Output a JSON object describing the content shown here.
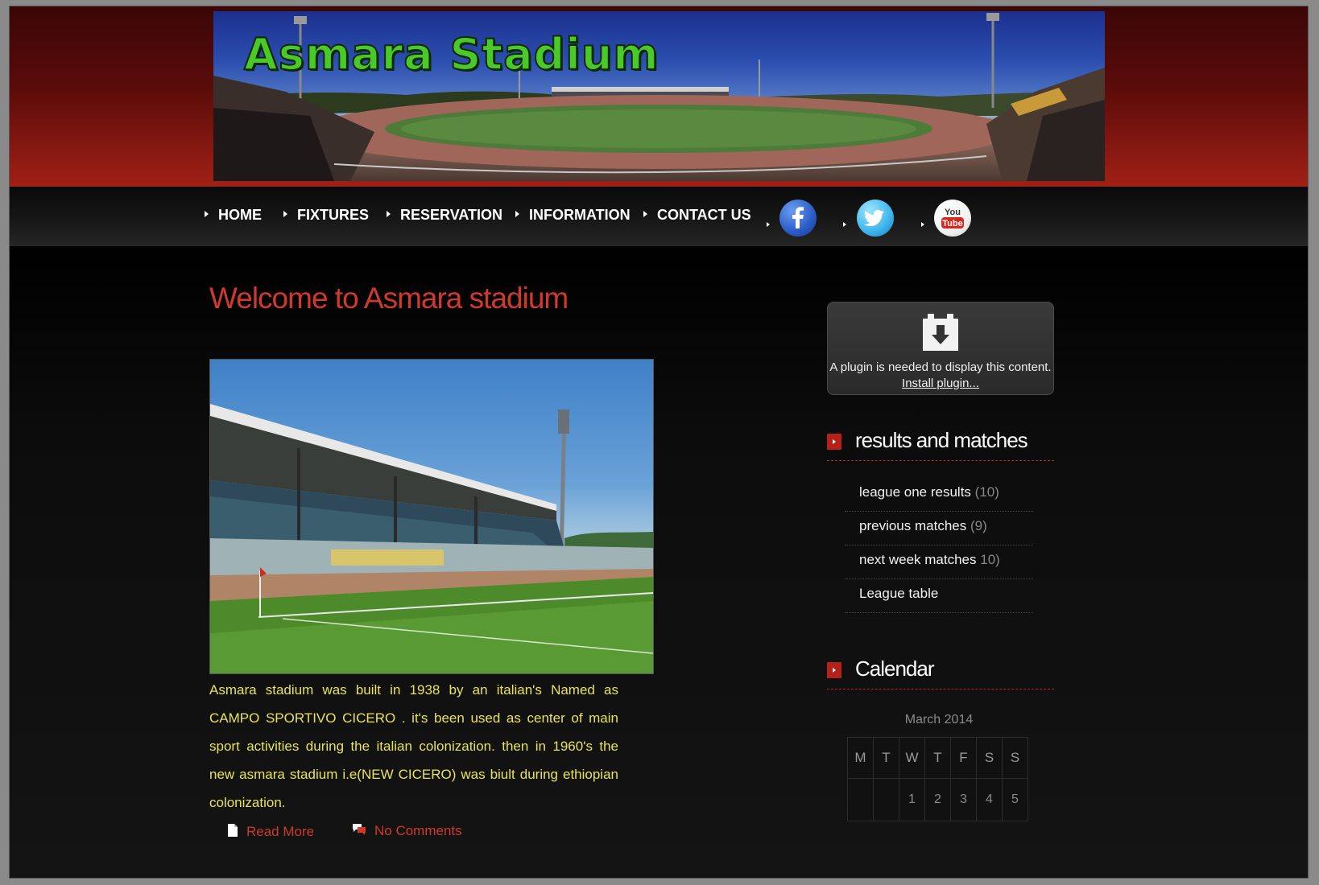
{
  "site": {
    "title": "Asmara Stadium"
  },
  "nav": {
    "items": [
      "HOME",
      "FIXTURES",
      "RESERVATION",
      "INFORMATION",
      "CONTACT US"
    ],
    "social": [
      "facebook-icon",
      "twitter-icon",
      "youtube-icon"
    ],
    "youtube_top": "You",
    "youtube_bottom": "Tube"
  },
  "post": {
    "title": "Welcome to Asmara stadium",
    "body": "Asmara stadium was built in 1938 by an italian's Named as CAMPO SPORTIVO CICERO . it's been used as center of main sport activities during the italian colonization. then in 1960's the new asmara stadium i.e(NEW CICERO) was biult during ethiopian colonization.",
    "read_more": "Read More",
    "comments": "No Comments"
  },
  "plugin": {
    "message": "A plugin is needed to display this content.",
    "link": "Install plugin..."
  },
  "results_widget": {
    "title": "results and matches",
    "items": [
      {
        "label": "league one results",
        "count": "(10)"
      },
      {
        "label": "previous matches",
        "count": "(9)"
      },
      {
        "label": "next week matches",
        "count": "10)"
      },
      {
        "label": "League table",
        "count": ""
      }
    ]
  },
  "calendar": {
    "title": "Calendar",
    "caption": "March 2014",
    "weekdays": [
      "M",
      "T",
      "W",
      "T",
      "F",
      "S",
      "S"
    ],
    "week1": [
      "",
      "",
      "1",
      "2",
      "3",
      "4",
      "5"
    ]
  },
  "colors": {
    "accent_red": "#d0392b",
    "body_text_yellow": "#e8e356",
    "banner_title_green": "#4cc92a"
  }
}
